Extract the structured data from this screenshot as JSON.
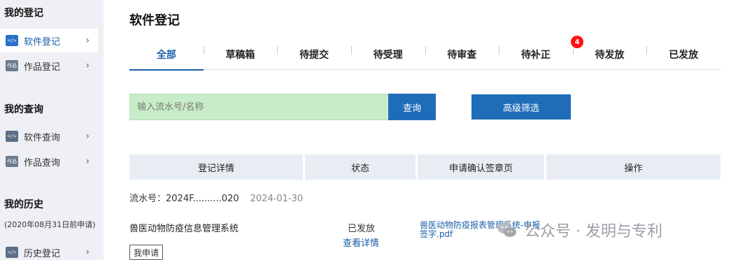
{
  "sidebar": {
    "sections": [
      {
        "title": "我的登记",
        "items": [
          {
            "label": "软件登记",
            "icon": "code-icon",
            "icon_text": "</>"
          },
          {
            "label": "作品登记",
            "icon": "document-icon",
            "icon_text": "作品"
          }
        ]
      },
      {
        "title": "我的查询",
        "items": [
          {
            "label": "软件查询",
            "icon": "code-icon",
            "icon_text": "</>"
          },
          {
            "label": "作品查询",
            "icon": "document-icon",
            "icon_text": "作品"
          }
        ]
      },
      {
        "title": "我的历史",
        "note": "(2020年08月31日前申请)",
        "items": [
          {
            "label": "历史登记",
            "icon": "code-icon",
            "icon_text": "</>"
          }
        ]
      }
    ],
    "chevron": "›"
  },
  "page": {
    "title": "软件登记"
  },
  "tabs": [
    {
      "label": "全部"
    },
    {
      "label": "草稿箱"
    },
    {
      "label": "待提交"
    },
    {
      "label": "待受理"
    },
    {
      "label": "待审查"
    },
    {
      "label": "待补正",
      "badge": "4"
    },
    {
      "label": "待发放"
    },
    {
      "label": "已发放"
    }
  ],
  "search": {
    "placeholder": "输入流水号/名称",
    "query_label": "查询",
    "advanced_label": "高级筛选"
  },
  "table": {
    "headers": [
      "登记详情",
      "状态",
      "申请确认签章页",
      "操作"
    ]
  },
  "record": {
    "serial_label": "流水号：2024F..........020",
    "date": "2024-01-30",
    "name": "兽医动物防疫信息管理系统",
    "status": "已发放",
    "detail_link": "查看详情",
    "file_link": "兽医动物防疫报表管理系统-申报 签字.pdf",
    "tag": "我申请"
  },
  "watermark": {
    "text": "公众号 · 发明与专利"
  },
  "colors": {
    "accent": "#1f6cb8",
    "badge": "#ff1111",
    "search_bg": "#c8ebc8",
    "sidebar_bg": "#eef0f5",
    "header_bg": "#e8edf4"
  }
}
